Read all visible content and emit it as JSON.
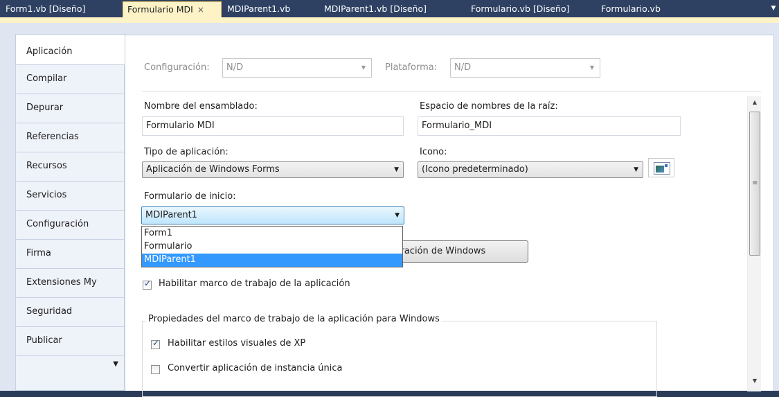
{
  "tabs": [
    {
      "label": "Form1.vb [Diseño]",
      "active": false
    },
    {
      "label": "Formulario MDI",
      "active": true,
      "close": "×"
    },
    {
      "label": "MDIParent1.vb",
      "active": false
    },
    {
      "label": "MDIParent1.vb [Diseño]",
      "active": false
    },
    {
      "label": "Formulario.vb [Diseño]",
      "active": false
    },
    {
      "label": "Formulario.vb",
      "active": false
    }
  ],
  "side_tabs": [
    "Aplicación",
    "Compilar",
    "Depurar",
    "Referencias",
    "Recursos",
    "Servicios",
    "Configuración",
    "Firma",
    "Extensiones My",
    "Seguridad",
    "Publicar"
  ],
  "config": {
    "label": "Configuración:",
    "value": "N/D"
  },
  "platform": {
    "label": "Plataforma:",
    "value": "N/D"
  },
  "assembly": {
    "label": "Nombre del ensamblado:",
    "value": "Formulario MDI"
  },
  "namespace": {
    "label": "Espacio de nombres de la raíz:",
    "value": "Formulario_MDI"
  },
  "app_type": {
    "label": "Tipo de aplicación:",
    "value": "Aplicación de Windows Forms"
  },
  "icon": {
    "label": "Icono:",
    "value": "(Icono predeterminado)"
  },
  "startup": {
    "label": "Formulario de inicio:",
    "value": "MDIParent1",
    "options": [
      "Form1",
      "Formulario",
      "MDIParent1"
    ],
    "selected": "MDIParent1"
  },
  "uac_button": {
    "label": "guración de Windows"
  },
  "enable_framework": {
    "label": "Habilitar marco de trabajo de la aplicación",
    "checked": true
  },
  "framework_group": {
    "title": "Propiedades del marco de trabajo de la aplicación para Windows",
    "visual_styles": {
      "label": "Habilitar estilos visuales de XP",
      "checked": true
    },
    "single_instance": {
      "label": "Convertir aplicación de instancia única",
      "checked": false
    }
  },
  "colors": {
    "tab_strip": "#2e4163",
    "active_tab": "#fdf3c7",
    "selection": "#3399ff"
  }
}
